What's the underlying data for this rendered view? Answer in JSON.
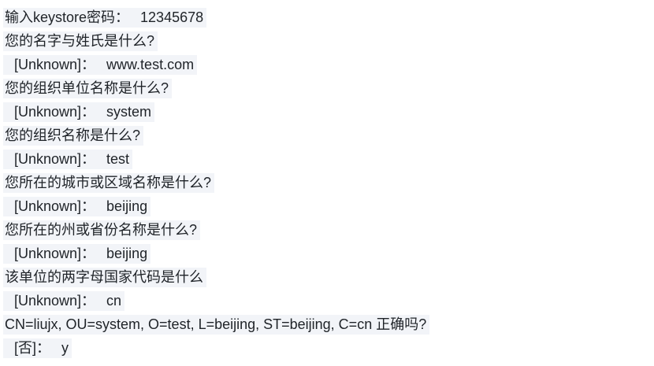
{
  "lines": [
    {
      "label": "输入keystore密码：",
      "value": "12345678",
      "type": "question"
    },
    {
      "label": "您的名字与姓氏是什么?",
      "value": "",
      "type": "question"
    },
    {
      "label": "[Unknown]：",
      "value": "www.test.com",
      "type": "answer"
    },
    {
      "label": "您的组织单位名称是什么?",
      "value": "",
      "type": "question"
    },
    {
      "label": "[Unknown]：",
      "value": "system",
      "type": "answer"
    },
    {
      "label": "您的组织名称是什么?",
      "value": "",
      "type": "question"
    },
    {
      "label": "[Unknown]：",
      "value": "test",
      "type": "answer"
    },
    {
      "label": "您所在的城市或区域名称是什么?",
      "value": "",
      "type": "question"
    },
    {
      "label": "[Unknown]：",
      "value": "beijing",
      "type": "answer"
    },
    {
      "label": "您所在的州或省份名称是什么?",
      "value": "",
      "type": "question"
    },
    {
      "label": "[Unknown]：",
      "value": "beijing",
      "type": "answer"
    },
    {
      "label": "该单位的两字母国家代码是什么",
      "value": "",
      "type": "question"
    },
    {
      "label": "[Unknown]：",
      "value": "cn",
      "type": "answer"
    },
    {
      "label": "CN=liujx, OU=system, O=test, L=beijing, ST=beijing, C=cn 正确吗?",
      "value": "",
      "type": "question"
    },
    {
      "label": "[否]：",
      "value": "y",
      "type": "answer"
    }
  ],
  "colors": {
    "text": "#1f2328",
    "highlight": "#f2f4f8",
    "background": "#ffffff"
  }
}
